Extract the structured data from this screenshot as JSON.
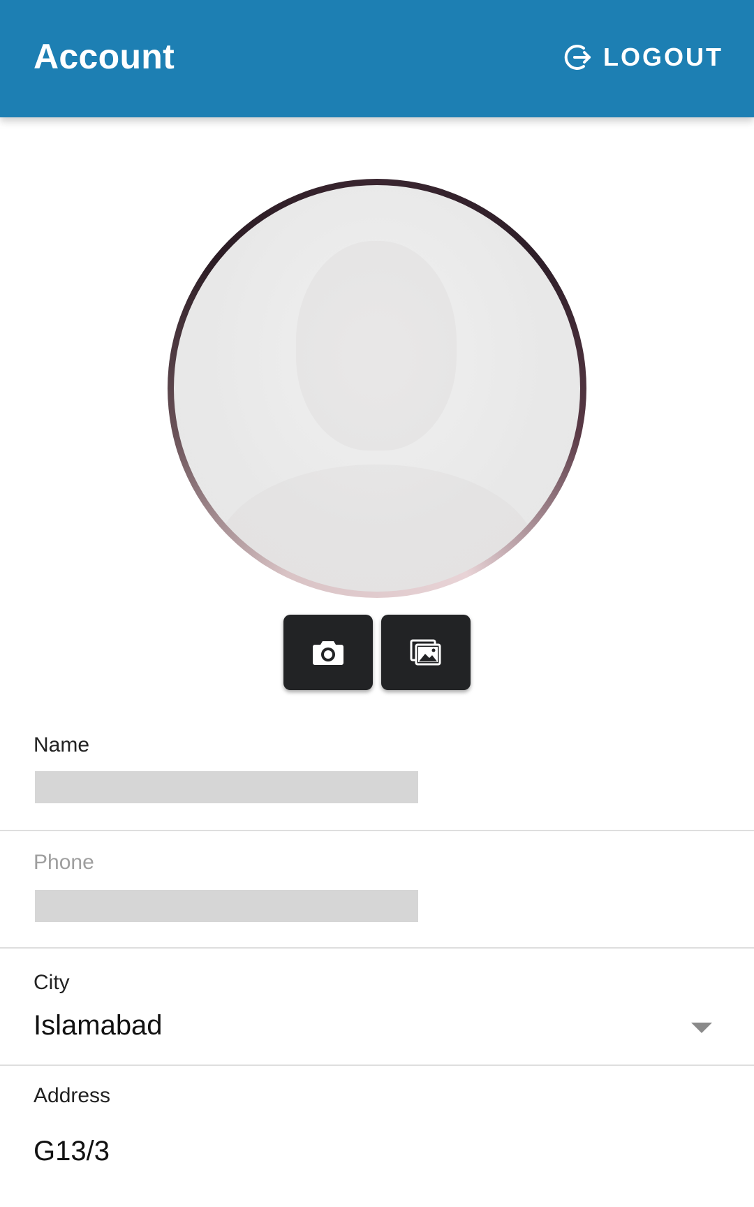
{
  "header": {
    "title": "Account",
    "logout_label": "LOGOUT"
  },
  "icons": {
    "logout": "logout-icon",
    "camera": "camera-icon",
    "gallery": "gallery-icon",
    "dropdown": "chevron-down-icon"
  },
  "colors": {
    "header_bg": "#1d7fb3",
    "button_bg": "#222325"
  },
  "form": {
    "name": {
      "label": "Name",
      "value": ""
    },
    "phone": {
      "label": "Phone",
      "value": ""
    },
    "city": {
      "label": "City",
      "value": "Islamabad"
    },
    "address": {
      "label": "Address",
      "value": "G13/3"
    }
  }
}
